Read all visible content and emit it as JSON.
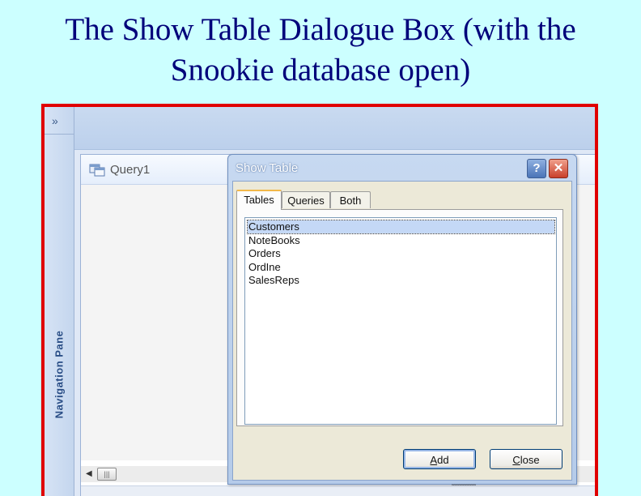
{
  "slide": {
    "title_line1": "The Show Table Dialogue Box (with the",
    "title_line2": "Snookie database open)"
  },
  "navigation_pane": {
    "expand_glyph": "»",
    "label": "Navigation Pane"
  },
  "query_window": {
    "title": "Query1",
    "icon": "query-icon"
  },
  "dialog": {
    "title": "Show Table",
    "help_glyph": "?",
    "close_glyph": "✕",
    "tabs": [
      {
        "label": "Tables",
        "active": true
      },
      {
        "label": "Queries",
        "active": false
      },
      {
        "label": "Both",
        "active": false
      }
    ],
    "tables": [
      {
        "name": "Customers",
        "selected": true
      },
      {
        "name": "NoteBooks",
        "selected": false
      },
      {
        "name": "Orders",
        "selected": false
      },
      {
        "name": "OrdIne",
        "selected": false
      },
      {
        "name": "SalesReps",
        "selected": false
      }
    ],
    "add_button": {
      "first": "A",
      "rest": "dd"
    },
    "close_button": {
      "first": "C",
      "rest": "lose"
    }
  },
  "colors": {
    "slide_background": "#ccffff",
    "title_text": "#00007a",
    "frame_border": "#e00000",
    "selection": "#c4d8f6"
  }
}
